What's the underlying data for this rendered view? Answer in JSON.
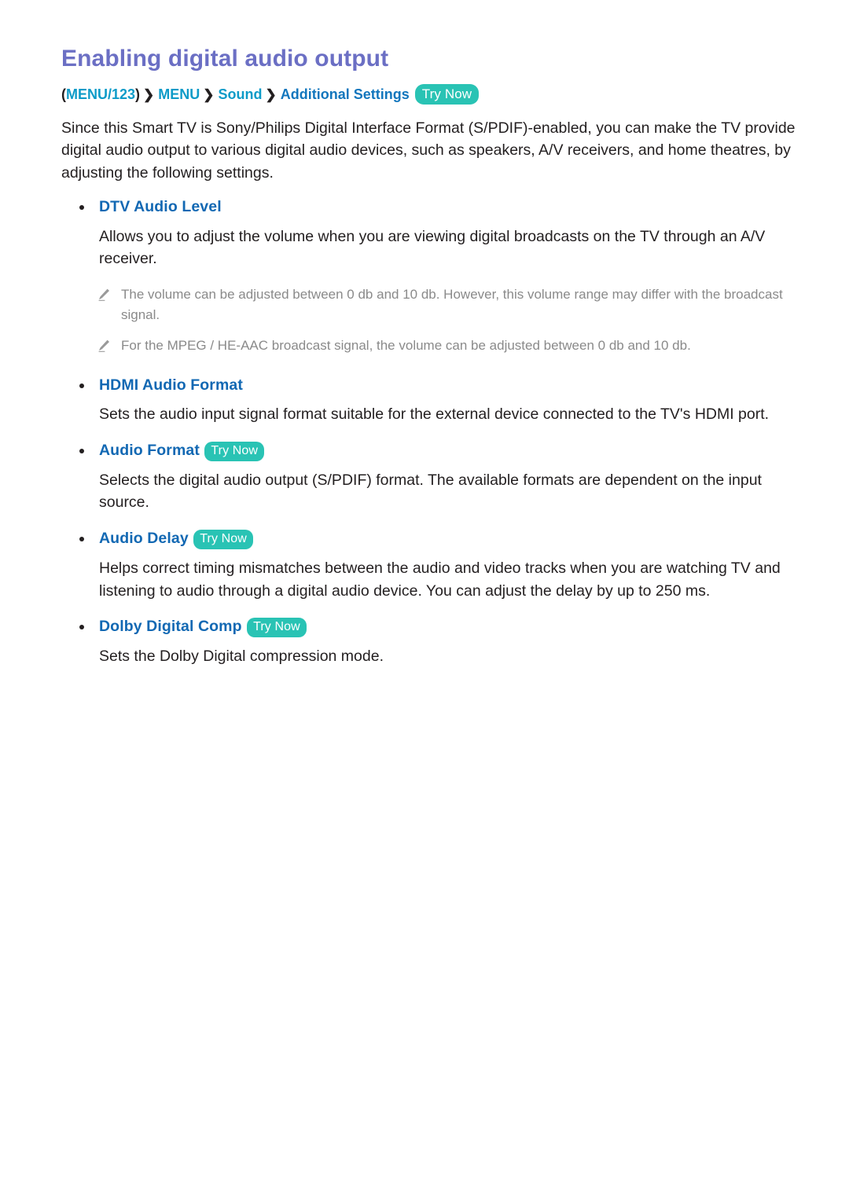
{
  "document": {
    "title": "Enabling digital audio output",
    "breadcrumb": {
      "open_paren": "(",
      "close_paren": ")",
      "items": [
        {
          "label": "MENU/123",
          "style": "teal"
        },
        {
          "label": "MENU",
          "style": "teal"
        },
        {
          "label": "Sound",
          "style": "teal"
        },
        {
          "label": "Additional Settings",
          "style": "blue"
        }
      ],
      "separator": "❯",
      "try_now_label": "Try Now"
    },
    "intro": "Since this Smart TV is Sony/Philips Digital Interface Format (S/PDIF)-enabled, you can make the TV provide digital audio output to various digital audio devices, such as speakers, A/V receivers, and home theatres, by adjusting the following settings.",
    "sections": [
      {
        "heading": "DTV Audio Level",
        "try_now": "",
        "body": "Allows you to adjust the volume when you are viewing digital broadcasts on the TV through an A/V receiver.",
        "notes": [
          "The volume can be adjusted between 0 db and 10 db. However, this volume range may differ with the broadcast signal.",
          "For the MPEG / HE-AAC broadcast signal, the volume can be adjusted between 0 db and 10 db."
        ]
      },
      {
        "heading": "HDMI Audio Format",
        "try_now": "",
        "body": "Sets the audio input signal format suitable for the external device connected to the TV's HDMI port.",
        "notes": []
      },
      {
        "heading": "Audio Format",
        "try_now": "Try Now",
        "body": "Selects the digital audio output (S/PDIF) format. The available formats are dependent on the input source.",
        "notes": []
      },
      {
        "heading": "Audio Delay",
        "try_now": "Try Now",
        "body": "Helps correct timing mismatches between the audio and video tracks when you are watching TV and listening to audio through a digital audio device. You can adjust the delay by up to 250 ms.",
        "notes": []
      },
      {
        "heading": "Dolby Digital Comp",
        "try_now": "Try Now",
        "body": "Sets the Dolby Digital compression mode.",
        "notes": []
      }
    ],
    "icons": {
      "note": "pencil-icon",
      "bullet": "bullet-dot-icon",
      "separator": "chevron-right-icon"
    },
    "colors": {
      "title": "#6b6fc4",
      "heading": "#1268b3",
      "breadcrumb_teal": "#0d9bc8",
      "breadcrumb_blue": "#1276bd",
      "try_now_bg": "#29c3b4",
      "body": "#231f20",
      "note": "#8a8a8a",
      "background": "#ffffff"
    }
  }
}
